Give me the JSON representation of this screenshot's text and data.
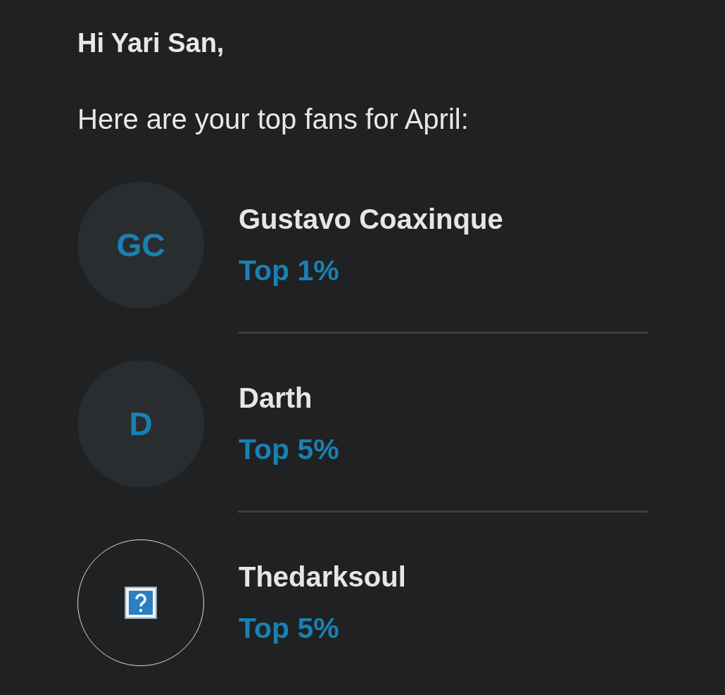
{
  "greeting": "Hi Yari San,",
  "intro": "Here are your top fans for April:",
  "fans": [
    {
      "kind": "initials",
      "initials": "GC",
      "name": "Gustavo Coaxinque",
      "rank": "Top 1%"
    },
    {
      "kind": "initials",
      "initials": "D",
      "name": "Darth",
      "rank": "Top 5%"
    },
    {
      "kind": "broken_image",
      "name": "Thedarksoul",
      "rank": "Top 5%"
    }
  ]
}
